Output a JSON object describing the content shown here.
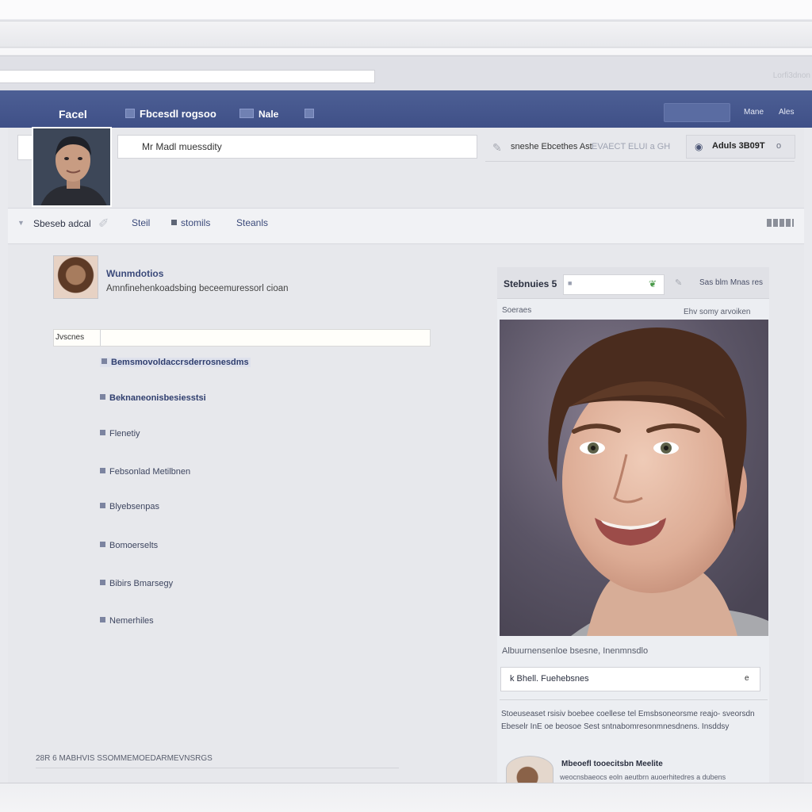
{
  "browser": {
    "url": "",
    "right_text": "Lorfi3dnon"
  },
  "header": {
    "brand": "Facel",
    "nav_link_1": "Fbcesdl rogsoo",
    "nav_link_2": "Nale",
    "button": "",
    "link_1": "Mane",
    "link_2": "Ales",
    "color": "#45578e"
  },
  "profile": {
    "search_value": "Mr Madl muessdity",
    "search_info": "sneshe Ebcethes Ast",
    "search_info2": "EVAECT ELUI a GH",
    "friend_label": "Aduls 3B09T",
    "friend_close": "o"
  },
  "tabs": {
    "tab_1": "Sbeseb adcal",
    "tab_2": "Steil",
    "tab_3": "stomils",
    "tab_4": "Steanls"
  },
  "post": {
    "name": "Wunmdotios",
    "text": "Amnfinehenkoadsbing beceemuressorl cioan"
  },
  "filter": {
    "label": "Jvscnes"
  },
  "list": {
    "items": [
      "Bemsmovoldaccrsderrosnesdms",
      "Beknaneonisbesiesstsi",
      "Flenetiy",
      "Febsonlad Metilbnen",
      "Blyebsenpas",
      "Bomoerselts",
      "Bibirs Bmarsegy",
      "Nemerhiles"
    ]
  },
  "footer": {
    "text": "28R 6 MABHVIS SSOMMEMOEDARMEVNSRGS"
  },
  "right_panel": {
    "title": "Stebnuies 5",
    "link": "Sas blm Mnas res",
    "sub_left": "Soeraes",
    "sub_right": "Ehv somy arvoiken",
    "caption": "Albuurnensenloe bsesne, Inenmnsdlo",
    "input_label": "k Bhell. Fuehebsnes",
    "input_button": "e",
    "body": "Stoeuseaset rsisiv boebee coellese tel Emsbsoneorsme reajo- sveorsdn Ebeselr InE oe beosoe Sest sntnabomresonmnesdnens. Insddsy",
    "friend_name": "Mbeoefl tooecitsbn Meelite",
    "friend_text": "weocnsbaeocs eoln aeutbrn auoerhitedres a dubens"
  }
}
